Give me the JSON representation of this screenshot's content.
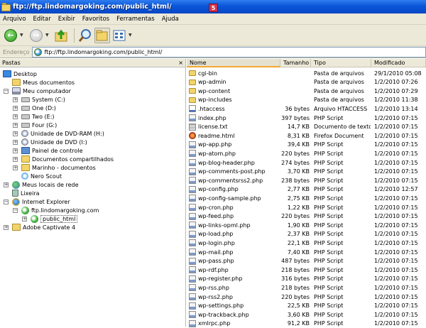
{
  "window": {
    "title": "ftp://ftp.lindomargoking.com/public_html/",
    "badge": "5"
  },
  "menu": [
    "Arquivo",
    "Editar",
    "Exibir",
    "Favoritos",
    "Ferramentas",
    "Ajuda"
  ],
  "toolbar": {
    "icons": [
      "back-icon",
      "forward-icon",
      "up-folder-icon",
      "search-icon",
      "folders-icon",
      "views-icon"
    ]
  },
  "address": {
    "label": "Endereço",
    "value": "ftp://ftp.lindomargoking.com/public_html/"
  },
  "left_pane": {
    "title": "Pastas",
    "close": "×",
    "tree": [
      {
        "label": "Desktop",
        "icon": "desktop-icon"
      },
      {
        "label": "Meus documentos",
        "icon": "folder-icon"
      },
      {
        "label": "Meu computador",
        "icon": "computer-icon"
      },
      {
        "label": "System (C:)",
        "icon": "drive-icon"
      },
      {
        "label": "One (D:)",
        "icon": "drive-icon"
      },
      {
        "label": "Two (E:)",
        "icon": "drive-icon"
      },
      {
        "label": "Four (G:)",
        "icon": "drive-icon"
      },
      {
        "label": "Unidade de DVD-RAM (H:)",
        "icon": "dvd-icon"
      },
      {
        "label": "Unidade de DVD (I:)",
        "icon": "dvd-icon"
      },
      {
        "label": "Painel de controle",
        "icon": "control-panel-icon"
      },
      {
        "label": "Documentos compartilhados",
        "icon": "folder-icon"
      },
      {
        "label": "Marinho - documentos",
        "icon": "folder-icon"
      },
      {
        "label": "Nero Scout",
        "icon": "scout-icon"
      },
      {
        "label": "Meus locais de rede",
        "icon": "network-icon"
      },
      {
        "label": "Lixeira",
        "icon": "recycle-bin-icon"
      },
      {
        "label": "Internet Explorer",
        "icon": "ie-icon"
      },
      {
        "label": "ftp.lindomargoking.com",
        "icon": "ftp-icon"
      },
      {
        "label": "public_html",
        "icon": "ftp-icon"
      },
      {
        "label": "Adobe Captivate 4",
        "icon": "folder-icon"
      }
    ]
  },
  "columns": [
    "Nome",
    "Tamanho",
    "Tipo",
    "Modificado"
  ],
  "files": [
    {
      "name": "cgi-bin",
      "size": "",
      "type": "Pasta de arquivos",
      "modified": "29/1/2010 05:08",
      "icon": "folder-icon"
    },
    {
      "name": "wp-admin",
      "size": "",
      "type": "Pasta de arquivos",
      "modified": "1/2/2010 07:26",
      "icon": "folder-icon"
    },
    {
      "name": "wp-content",
      "size": "",
      "type": "Pasta de arquivos",
      "modified": "1/2/2010 07:29",
      "icon": "folder-icon"
    },
    {
      "name": "wp-includes",
      "size": "",
      "type": "Pasta de arquivos",
      "modified": "1/2/2010 11:38",
      "icon": "folder-icon"
    },
    {
      "name": ".htaccess",
      "size": "36 bytes",
      "type": "Arquivo HTACCESS",
      "modified": "1/2/2010 13:14",
      "icon": "file-icon"
    },
    {
      "name": "index.php",
      "size": "397 bytes",
      "type": "PHP Script",
      "modified": "1/2/2010 07:15",
      "icon": "php-icon"
    },
    {
      "name": "license.txt",
      "size": "14,7 KB",
      "type": "Documento de texto",
      "modified": "1/2/2010 07:15",
      "icon": "text-icon"
    },
    {
      "name": "readme.html",
      "size": "8,31 KB",
      "type": "Firefox Document",
      "modified": "1/2/2010 07:15",
      "icon": "firefox-icon"
    },
    {
      "name": "wp-app.php",
      "size": "39,4 KB",
      "type": "PHP Script",
      "modified": "1/2/2010 07:15",
      "icon": "php-icon"
    },
    {
      "name": "wp-atom.php",
      "size": "220 bytes",
      "type": "PHP Script",
      "modified": "1/2/2010 07:15",
      "icon": "php-icon"
    },
    {
      "name": "wp-blog-header.php",
      "size": "274 bytes",
      "type": "PHP Script",
      "modified": "1/2/2010 07:15",
      "icon": "php-icon"
    },
    {
      "name": "wp-comments-post.php",
      "size": "3,70 KB",
      "type": "PHP Script",
      "modified": "1/2/2010 07:15",
      "icon": "php-icon"
    },
    {
      "name": "wp-commentsrss2.php",
      "size": "238 bytes",
      "type": "PHP Script",
      "modified": "1/2/2010 07:15",
      "icon": "php-icon"
    },
    {
      "name": "wp-config.php",
      "size": "2,77 KB",
      "type": "PHP Script",
      "modified": "1/2/2010 12:57",
      "icon": "php-icon"
    },
    {
      "name": "wp-config-sample.php",
      "size": "2,75 KB",
      "type": "PHP Script",
      "modified": "1/2/2010 07:15",
      "icon": "php-icon"
    },
    {
      "name": "wp-cron.php",
      "size": "1,22 KB",
      "type": "PHP Script",
      "modified": "1/2/2010 07:15",
      "icon": "php-icon"
    },
    {
      "name": "wp-feed.php",
      "size": "220 bytes",
      "type": "PHP Script",
      "modified": "1/2/2010 07:15",
      "icon": "php-icon"
    },
    {
      "name": "wp-links-opml.php",
      "size": "1,90 KB",
      "type": "PHP Script",
      "modified": "1/2/2010 07:15",
      "icon": "php-icon"
    },
    {
      "name": "wp-load.php",
      "size": "2,37 KB",
      "type": "PHP Script",
      "modified": "1/2/2010 07:15",
      "icon": "php-icon"
    },
    {
      "name": "wp-login.php",
      "size": "22,1 KB",
      "type": "PHP Script",
      "modified": "1/2/2010 07:15",
      "icon": "php-icon"
    },
    {
      "name": "wp-mail.php",
      "size": "7,40 KB",
      "type": "PHP Script",
      "modified": "1/2/2010 07:15",
      "icon": "php-icon"
    },
    {
      "name": "wp-pass.php",
      "size": "487 bytes",
      "type": "PHP Script",
      "modified": "1/2/2010 07:15",
      "icon": "php-icon"
    },
    {
      "name": "wp-rdf.php",
      "size": "218 bytes",
      "type": "PHP Script",
      "modified": "1/2/2010 07:15",
      "icon": "php-icon"
    },
    {
      "name": "wp-register.php",
      "size": "316 bytes",
      "type": "PHP Script",
      "modified": "1/2/2010 07:15",
      "icon": "php-icon"
    },
    {
      "name": "wp-rss.php",
      "size": "218 bytes",
      "type": "PHP Script",
      "modified": "1/2/2010 07:15",
      "icon": "php-icon"
    },
    {
      "name": "wp-rss2.php",
      "size": "220 bytes",
      "type": "PHP Script",
      "modified": "1/2/2010 07:15",
      "icon": "php-icon"
    },
    {
      "name": "wp-settings.php",
      "size": "22,5 KB",
      "type": "PHP Script",
      "modified": "1/2/2010 07:15",
      "icon": "php-icon"
    },
    {
      "name": "wp-trackback.php",
      "size": "3,60 KB",
      "type": "PHP Script",
      "modified": "1/2/2010 07:15",
      "icon": "php-icon"
    },
    {
      "name": "xmlrpc.php",
      "size": "91,2 KB",
      "type": "PHP Script",
      "modified": "1/2/2010 07:15",
      "icon": "php-icon"
    }
  ]
}
